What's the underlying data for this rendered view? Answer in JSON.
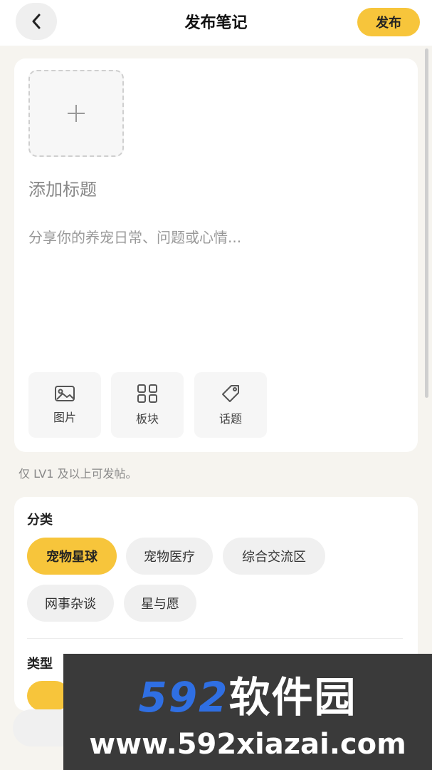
{
  "header": {
    "title": "发布笔记",
    "publish_label": "发布"
  },
  "editor": {
    "title_placeholder": "添加标题",
    "body_placeholder": "分享你的养宠日常、问题或心情...",
    "tools": [
      {
        "label": "图片",
        "icon": "image-icon"
      },
      {
        "label": "板块",
        "icon": "grid-icon"
      },
      {
        "label": "话题",
        "icon": "tag-icon"
      }
    ]
  },
  "hint": "仅 LV1 及以上可发帖。",
  "category": {
    "label": "分类",
    "chips": [
      {
        "label": "宠物星球",
        "selected": true
      },
      {
        "label": "宠物医疗",
        "selected": false
      },
      {
        "label": "综合交流区",
        "selected": false
      },
      {
        "label": "网事杂谈",
        "selected": false
      },
      {
        "label": "星与愿",
        "selected": false
      }
    ]
  },
  "type": {
    "label": "类型"
  },
  "watermark": {
    "number": "592",
    "brand": "软件园",
    "url": "www.592xiazai.com"
  },
  "colors": {
    "accent": "#f7c53b",
    "background": "#f6f4ef",
    "watermark_blue": "#2f6fe3"
  }
}
